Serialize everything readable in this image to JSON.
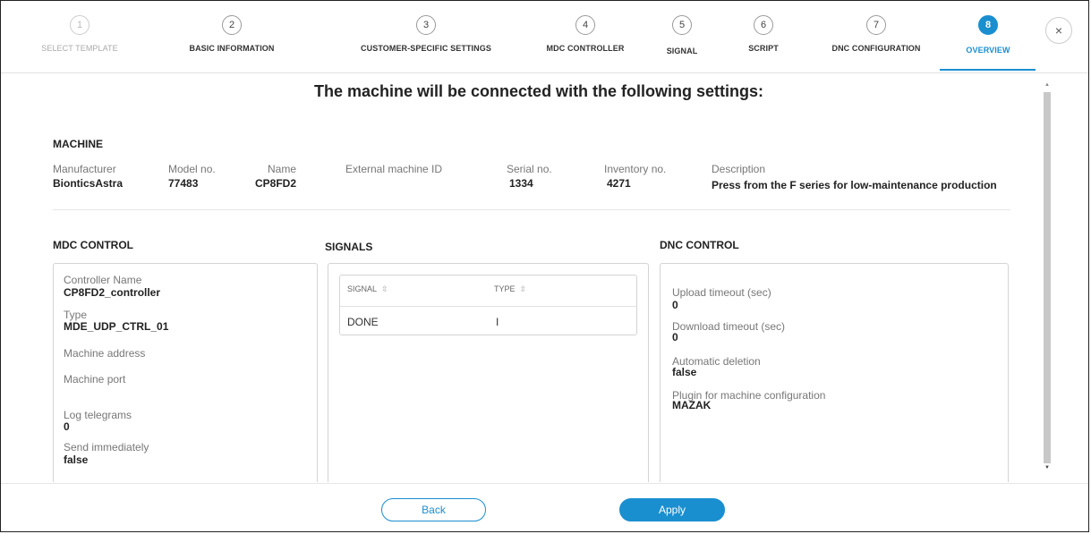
{
  "wizard": {
    "steps": [
      {
        "number": "1",
        "label": "SELECT TEMPLATE"
      },
      {
        "number": "2",
        "label": "BASIC INFORMATION"
      },
      {
        "number": "3",
        "label": "CUSTOMER-SPECIFIC SETTINGS"
      },
      {
        "number": "4",
        "label": "MDC CONTROLLER"
      },
      {
        "number": "5",
        "label": "SIGNAL"
      },
      {
        "number": "6",
        "label": "SCRIPT"
      },
      {
        "number": "7",
        "label": "DNC CONFIGURATION"
      },
      {
        "number": "8",
        "label": "OVERVIEW"
      }
    ],
    "active_step": 8,
    "close_icon": "×",
    "accent_color": "#1a8fd0"
  },
  "page": {
    "title": "The machine will be connected with the following settings:"
  },
  "machine": {
    "heading": "MACHINE",
    "fields": [
      {
        "label": "Manufacturer",
        "value": "BionticsAstra"
      },
      {
        "label": "Model no.",
        "value": "77483"
      },
      {
        "label": "Name",
        "value": "CP8FD2"
      },
      {
        "label": "External machine ID",
        "value": ""
      },
      {
        "label": "Serial no.",
        "value": "1334"
      },
      {
        "label": "Inventory no.",
        "value": "4271"
      },
      {
        "label": "Description",
        "value": "Press from the F series for low-maintenance production"
      }
    ]
  },
  "mdc": {
    "heading": "MDC CONTROL",
    "fields": [
      {
        "label": "Controller Name",
        "value": "CP8FD2_controller"
      },
      {
        "label": "Type",
        "value": "MDE_UDP_CTRL_01"
      },
      {
        "label": "Machine address",
        "value": ""
      },
      {
        "label": "Machine port",
        "value": ""
      },
      {
        "label": "Log telegrams",
        "value": "0"
      },
      {
        "label": "Send immediately",
        "value": "false"
      }
    ]
  },
  "signals": {
    "heading": "SIGNALS",
    "columns": [
      "SIGNAL",
      "TYPE"
    ],
    "sort_icon": "⇳",
    "rows": [
      {
        "signal": "DONE",
        "type": "I"
      }
    ]
  },
  "dnc": {
    "heading": "DNC CONTROL",
    "fields": [
      {
        "label": "Upload timeout (sec)",
        "value": "0"
      },
      {
        "label": "Download timeout (sec)",
        "value": "0"
      },
      {
        "label": "Automatic deletion",
        "value": "false"
      },
      {
        "label": "Plugin for machine configuration",
        "value": "MAZAK"
      }
    ]
  },
  "footer": {
    "back_label": "Back",
    "apply_label": "Apply"
  }
}
